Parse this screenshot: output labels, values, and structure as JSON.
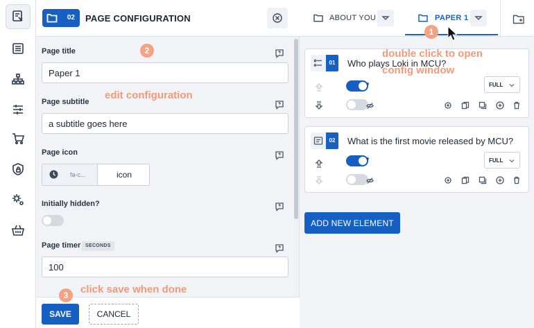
{
  "config_panel": {
    "badge_number": "02",
    "title": "PAGE CONFIGURATION",
    "fields": {
      "page_title_label": "Page title",
      "page_title_value": "Paper 1",
      "page_subtitle_label": "Page subtitle",
      "page_subtitle_value": "a subtitle goes here",
      "page_icon_label": "Page icon",
      "page_icon_value": "fa-c...",
      "page_icon_button": "icon",
      "initially_hidden_label": "Initially hidden?",
      "initially_hidden": false,
      "page_timer_label": "Page timer",
      "page_timer_unit": "SECONDS",
      "page_timer_value": "100"
    },
    "save_label": "SAVE",
    "cancel_label": "CANCEL"
  },
  "tabs": [
    {
      "label": "ABOUT YOU",
      "active": false
    },
    {
      "label": "PAPER 1",
      "active": true
    }
  ],
  "questions": [
    {
      "number": "01",
      "text": "Who plays Loki in MCU?",
      "required": true,
      "hidden": false,
      "width": "FULL"
    },
    {
      "number": "02",
      "text": "What is the first movie released by MCU?",
      "required": true,
      "hidden": false,
      "width": "FULL"
    }
  ],
  "required_marker": "*",
  "add_element_label": "ADD NEW ELEMENT",
  "annotations": {
    "marker_1": "1",
    "marker_2": "2",
    "marker_3": "3",
    "double_click_line1": "double click to open",
    "double_click_line2": "config window",
    "edit_config": "edit configuration",
    "click_save": "click save when done"
  },
  "colors": {
    "primary": "#1660c4",
    "annotation": "#f29a76",
    "panel_bg": "#f1f3f6"
  },
  "icons": {
    "rail": [
      "forms-icon",
      "list-icon",
      "sitemap-icon",
      "sliders-icon",
      "cart-icon",
      "shield-lock-icon",
      "gears-icon",
      "basket-icon"
    ]
  }
}
